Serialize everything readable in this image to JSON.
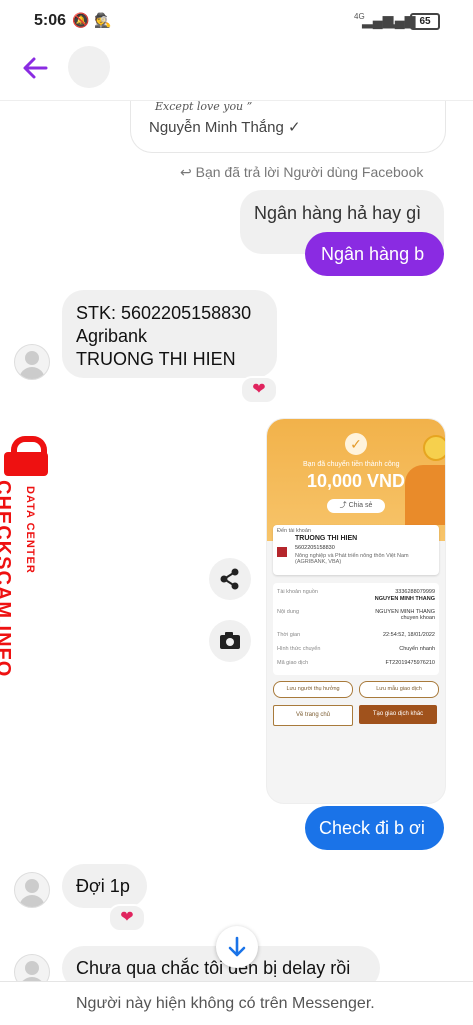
{
  "status_bar": {
    "time": "5:06",
    "battery": "65",
    "network": "4G"
  },
  "header": {
    "back_icon": "arrow-left-icon"
  },
  "quoted": {
    "signature": "Except love you ”",
    "name": "Nguyễn Minh Thắng ✓"
  },
  "reply_label": "Bạn đã trả lời Người dùng Facebook",
  "messages": {
    "m1": "Ngân hàng hả hay gì",
    "m2": "Ngân hàng b",
    "m3": [
      "STK: 5602205158830",
      "Agribank",
      "TRUONG THI HIEN"
    ],
    "m4": "Check đi b ơi",
    "m5": "Đợi 1p",
    "m6": "Chưa qua chắc tôi đến bị delay rồi"
  },
  "reaction": "❤",
  "watermark": {
    "main": "CHECKSCAM.INFO",
    "sub": "DATA CENTER"
  },
  "receipt": {
    "title": "Bạn đã chuyển tiền thành công",
    "amount": "10,000 VND",
    "share": "Chia sẻ",
    "to_label": "Đến tài khoản",
    "to_name": "TRUONG THI HIEN",
    "to_account": "5602205158830",
    "to_bank": "Nông nghiệp và Phát triển nông thôn Việt Nam (AGRIBANK, VBA)",
    "rows": [
      {
        "k": "Tài khoản nguồn",
        "v": "3336288079999"
      },
      {
        "k": "",
        "v": "NGUYEN MINH THANG"
      },
      {
        "k": "Nội dung",
        "v": "NGUYEN MINH THANG chuyen khoan"
      },
      {
        "k": "Thời gian",
        "v": "22:54:52, 18/01/2022"
      },
      {
        "k": "Hình thức chuyển",
        "v": "Chuyển nhanh"
      },
      {
        "k": "Mã giao dịch",
        "v": "FT22019475976210"
      }
    ],
    "btn_save_beneficiary": "Lưu người thụ hưởng",
    "btn_save_template": "Lưu mẫu giao dịch",
    "btn_home": "Về trang chủ",
    "btn_new": "Tạo giao dịch khác"
  },
  "footer": "Người này hiện không có trên Messenger."
}
